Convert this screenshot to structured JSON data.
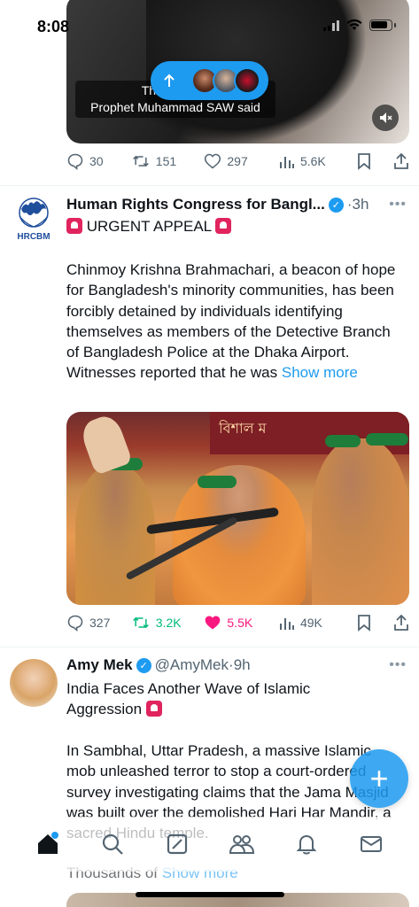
{
  "status_bar": {
    "time": "8:08"
  },
  "video_post": {
    "caption_line1": "They don't g",
    "caption_line2": "Prophet Muhammad SAW said",
    "actions": {
      "replies": "30",
      "reposts": "151",
      "likes": "297",
      "views": "5.6K"
    }
  },
  "tweet1": {
    "author": "Human Rights Congress for Bangl...",
    "time": "3h",
    "dot": "·",
    "title": "URGENT APPEAL",
    "avatar_text": "HRCBM",
    "body": "Chinmoy Krishna Brahmachari, a beacon of hope for Bangladesh's minority communities, has been forcibly detained by individuals identifying themselves as members of the Detective Branch of Bangladesh Police at the Dhaka Airport. Witnesses reported that he was",
    "show_more": "Show more",
    "banner_text": "বিশাল ম",
    "actions": {
      "replies": "327",
      "reposts": "3.2K",
      "likes": "5.5K",
      "views": "49K"
    }
  },
  "tweet2": {
    "author": "Amy Mek",
    "handle": "@AmyMek",
    "dot": "·",
    "time": "9h",
    "title_line1": "India Faces Another Wave of Islamic",
    "title_line2": "Aggression",
    "body": "In Sambhal, Uttar Pradesh, a massive Islamic mob unleashed terror to stop a court-ordered survey investigating claims that the Jama Masjid was built over the demolished Hari Har Mandir, a sacred Hindu temple.",
    "trail_text": "Thousands of",
    "show_more": "Show more"
  },
  "fab": {
    "label": "+"
  },
  "colors": {
    "accent": "#1d9bf0",
    "like_active": "#f91880",
    "repost_active": "#00ba7c",
    "text": "#0f1419",
    "muted": "#536471"
  }
}
